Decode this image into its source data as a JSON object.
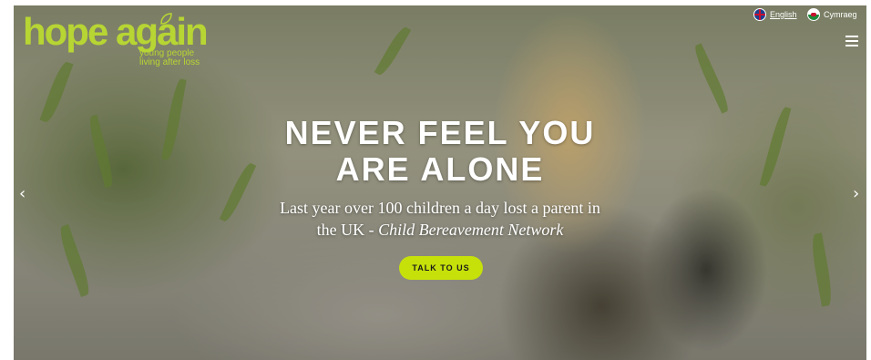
{
  "brand": {
    "name": "hope again",
    "tagline_line1": "young people",
    "tagline_line2": "living after loss",
    "accent_color": "#b7d533"
  },
  "language": {
    "english_label": "English",
    "welsh_label": "Cymraeg",
    "english_flag": "uk-flag-icon",
    "welsh_flag": "wales-flag-icon"
  },
  "menu": {
    "icon": "hamburger-menu-icon"
  },
  "hero": {
    "headline_line1": "NEVER FEEL YOU",
    "headline_line2": "ARE ALONE",
    "subtitle_plain": "Last year over 100 children a day lost a parent in",
    "subtitle_line2_prefix": "the UK - ",
    "subtitle_source": "Child Bereavement Network",
    "cta_label": "TALK TO US",
    "cta_color": "#c6e10a"
  },
  "carousel": {
    "prev_icon": "chevron-left-icon",
    "next_icon": "chevron-right-icon",
    "prev_glyph": "‹",
    "next_glyph": "›"
  }
}
